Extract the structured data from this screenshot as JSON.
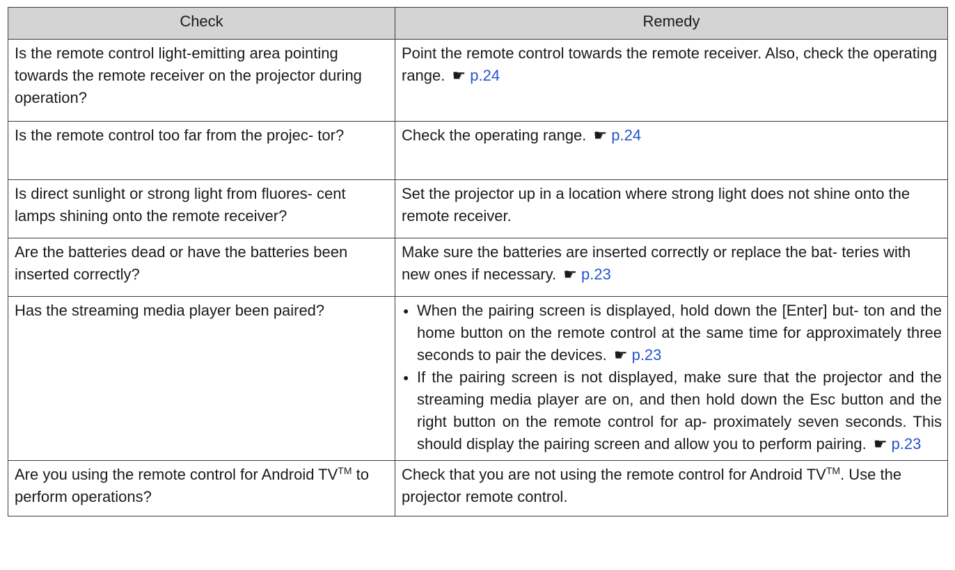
{
  "table": {
    "header": {
      "check": "Check",
      "remedy": "Remedy"
    },
    "rows": [
      {
        "check": "Is the remote control light-emitting area pointing towards the remote receiver on the projector during operation?",
        "remedy_text": "Point the remote control towards the remote receiver. Also, check the operating range.",
        "remedy_ref": "p.24"
      },
      {
        "check": "Is the remote control too far from the projec- tor?",
        "remedy_text": "Check the operating range.",
        "remedy_ref": "p.24"
      },
      {
        "check": "Is direct sunlight or strong light from fluores- cent lamps shining onto the remote receiver?",
        "remedy_text": "Set the projector up in a location where strong light does not shine onto the remote receiver."
      },
      {
        "check": "Are the batteries dead or have the batteries been inserted correctly?",
        "remedy_text": "Make sure the batteries are inserted correctly or replace the bat- teries with new ones if necessary.",
        "remedy_ref": "p.23"
      },
      {
        "check": "Has the streaming media player been paired?",
        "bullets": [
          {
            "text": "When the pairing screen is displayed, hold down the [Enter] but- ton and the home button on the remote control at the same time for approximately three seconds to pair the devices.",
            "ref": "p.23"
          },
          {
            "text": "If the pairing screen is not displayed, make sure that the projector and the streaming media player are on, and then hold down the Esc button and the right button on the remote control for ap- proximately seven seconds. This should display the pairing screen and allow you to perform pairing.",
            "ref": "p.23"
          }
        ]
      },
      {
        "check_prefix": "Are you using the remote control for Android TV",
        "check_sup": "TM",
        "check_suffix": " to perform operations?",
        "remedy_prefix": "Check that you are not using the remote control for Android TV",
        "remedy_sup": "TM",
        "remedy_suffix": ". Use the projector remote control."
      }
    ]
  },
  "icons": {
    "reference": "pointing-hand-icon"
  },
  "colors": {
    "header_bg": "#d4d4d4",
    "link": "#2255cc",
    "border": "#3a3a3a"
  }
}
